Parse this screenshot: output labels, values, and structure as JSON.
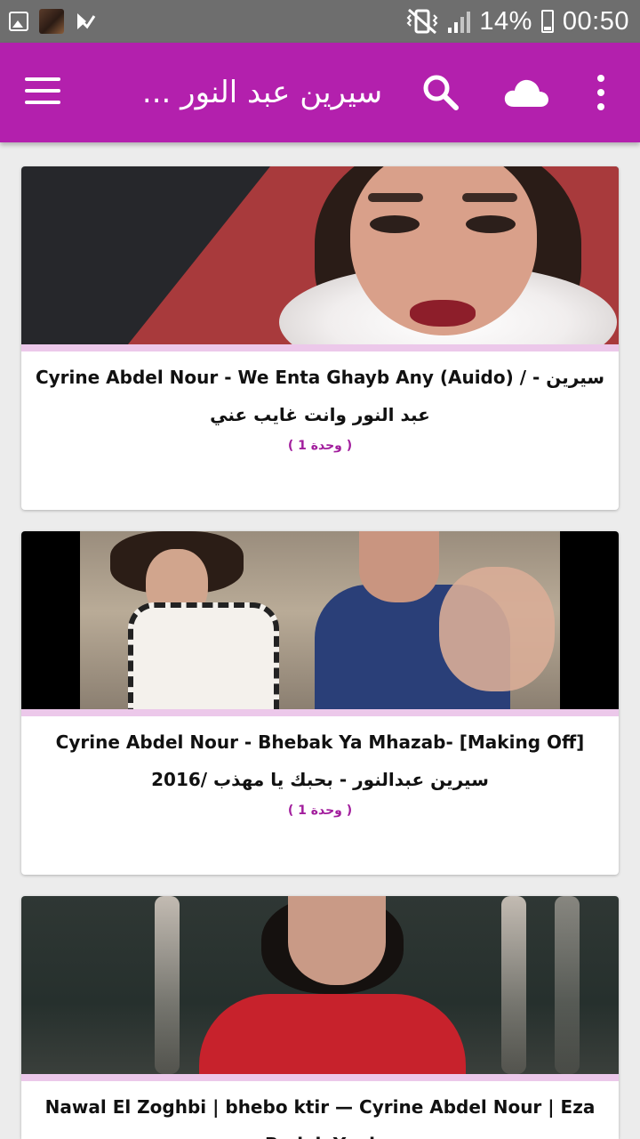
{
  "status_bar": {
    "battery": "14%",
    "time": "00:50"
  },
  "app_bar": {
    "title": "سيرين عبد النور ...",
    "icons": [
      "menu-icon",
      "search-icon",
      "cloud-icon",
      "more-vert-icon"
    ]
  },
  "colors": {
    "primary": "#b320ad",
    "accent_text": "#a21e9d",
    "divider": "#ecc8ea",
    "background": "#ececec"
  },
  "cards": [
    {
      "title": "Cyrine Abdel Nour - We Enta Ghayb Any (Auido) / - سيرين عبد النور وانت غايب عني",
      "count": "( 1 وحدة )"
    },
    {
      "title": "Cyrine Abdel Nour - Bhebak Ya Mhazab- [Making Off] 2016/ سيرين عبدالنور - بحبك يا مهذب",
      "count": "( 1 وحدة )"
    },
    {
      "title": "Nawal El Zoghbi | bhebo ktir — Cyrine Abdel Nour | Eza Badak Yani"
    }
  ]
}
